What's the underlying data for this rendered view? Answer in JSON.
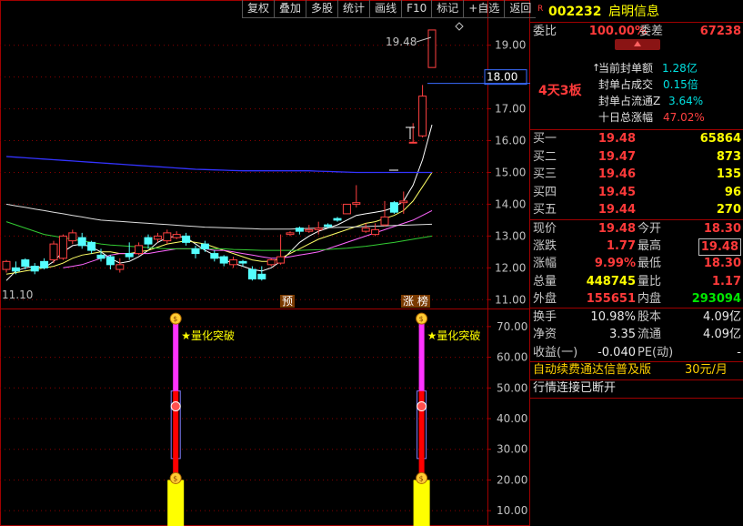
{
  "toolbar": [
    "复权",
    "叠加",
    "多股",
    "统计",
    "画线",
    "F10",
    "标记",
    "+自选",
    "返回"
  ],
  "stock": {
    "marker": "R",
    "code": "002232",
    "name": "启明信息"
  },
  "weibi": {
    "label": "委比",
    "value": "100.00%",
    "diff_label": "委差",
    "diff_value": "67238"
  },
  "limit_info": {
    "boards": "4天3板",
    "items": [
      {
        "label": "当前封单额",
        "value": "1.28亿"
      },
      {
        "label": "封单占成交",
        "value": "0.15倍"
      },
      {
        "label": "封单占流通Z",
        "value": "3.64%"
      },
      {
        "label": "十日总涨幅",
        "value": "47.02%"
      }
    ]
  },
  "bids": [
    {
      "label": "买一",
      "price": "19.48",
      "vol": "65864"
    },
    {
      "label": "买二",
      "price": "19.47",
      "vol": "873"
    },
    {
      "label": "买三",
      "price": "19.46",
      "vol": "135"
    },
    {
      "label": "买四",
      "price": "19.45",
      "vol": "96"
    },
    {
      "label": "买五",
      "price": "19.44",
      "vol": "270"
    }
  ],
  "quote": [
    {
      "l1": "现价",
      "v1": "19.48",
      "l2": "今开",
      "v2": "18.30"
    },
    {
      "l1": "涨跌",
      "v1": "1.77",
      "l2": "最高",
      "v2": "19.48"
    },
    {
      "l1": "涨幅",
      "v1": "9.99%",
      "l2": "最低",
      "v2": "18.30"
    },
    {
      "l1": "总量",
      "v1": "448745",
      "l2": "量比",
      "v2": "1.17"
    },
    {
      "l1": "外盘",
      "v1": "155651",
      "l2": "内盘",
      "v2": "293094"
    }
  ],
  "stats": [
    {
      "l1": "换手",
      "v1": "10.98%",
      "l2": "股本",
      "v2": "4.09亿"
    },
    {
      "l1": "净资",
      "v1": "3.35",
      "l2": "流通",
      "v2": "4.09亿"
    },
    {
      "l1": "收益(一)",
      "v1": "-0.040",
      "l2": "PE(动)",
      "v2": "-"
    }
  ],
  "notice": {
    "text": "自动续费通达信普及版",
    "price": "30元/月"
  },
  "status": "行情连接已断开",
  "chart_data": [
    {
      "type": "candlestick",
      "ylim": [
        10.75,
        19.85
      ],
      "yticks": [
        "19.00",
        "18.00",
        "17.00",
        "16.00",
        "15.00",
        "14.00",
        "13.00",
        "12.00",
        "11.00"
      ],
      "current_price_label": "18.00",
      "high_label": "19.48",
      "low_label": "11.10",
      "badges": [
        "预",
        "涨 榜"
      ],
      "candles": [
        [
          11.95,
          12.2,
          11.85,
          12.25
        ],
        [
          12.0,
          11.9,
          11.8,
          12.2
        ],
        [
          12.25,
          12.05,
          11.95,
          12.3
        ],
        [
          12.05,
          11.9,
          11.8,
          12.15
        ],
        [
          12.2,
          12.0,
          11.95,
          12.3
        ],
        [
          12.25,
          12.75,
          12.15,
          12.85
        ],
        [
          12.3,
          13.0,
          12.25,
          13.05
        ],
        [
          12.85,
          13.1,
          12.75,
          13.2
        ],
        [
          12.95,
          12.7,
          12.6,
          13.1
        ],
        [
          12.8,
          12.55,
          12.45,
          12.85
        ],
        [
          12.4,
          12.3,
          12.2,
          12.6
        ],
        [
          12.35,
          12.1,
          11.95,
          12.4
        ],
        [
          11.95,
          12.1,
          11.85,
          12.3
        ],
        [
          12.45,
          12.35,
          12.25,
          12.8
        ],
        [
          12.45,
          12.7,
          12.4,
          12.8
        ],
        [
          12.95,
          12.75,
          12.6,
          13.05
        ],
        [
          12.9,
          13.0,
          12.8,
          13.1
        ],
        [
          12.85,
          13.1,
          12.75,
          13.2
        ],
        [
          12.95,
          13.05,
          12.9,
          13.15
        ],
        [
          13.0,
          12.8,
          12.7,
          13.1
        ],
        [
          12.6,
          12.45,
          12.3,
          12.7
        ],
        [
          12.75,
          12.6,
          12.5,
          12.85
        ],
        [
          12.45,
          12.3,
          12.2,
          12.55
        ],
        [
          12.35,
          12.15,
          12.05,
          12.4
        ],
        [
          12.1,
          12.25,
          12.0,
          12.35
        ],
        [
          12.2,
          12.15,
          12.05,
          12.25
        ],
        [
          11.95,
          11.65,
          11.6,
          12.05
        ],
        [
          11.8,
          11.65,
          11.6,
          12.05
        ],
        [
          12.1,
          12.25,
          12.05,
          12.3
        ],
        [
          12.15,
          12.35,
          12.1,
          13.05
        ],
        [
          13.05,
          13.1,
          13.0,
          13.15
        ],
        [
          13.25,
          13.15,
          13.05,
          13.3
        ],
        [
          13.15,
          13.2,
          13.1,
          13.35
        ],
        [
          13.2,
          13.25,
          13.05,
          13.45
        ],
        [
          13.35,
          13.3,
          13.25,
          13.4
        ],
        [
          13.55,
          13.5,
          13.45,
          13.6
        ],
        [
          13.7,
          14.0,
          13.9,
          14.0
        ],
        [
          14.0,
          14.05,
          13.9,
          14.6
        ],
        [
          13.15,
          13.25,
          13.1,
          13.4
        ],
        [
          13.05,
          13.2,
          13.0,
          13.4
        ],
        [
          13.35,
          13.6,
          13.3,
          14.1
        ],
        [
          14.05,
          13.75,
          13.7,
          14.1
        ],
        [
          14.05,
          14.1,
          13.7,
          14.4
        ],
        [
          15.95,
          15.95,
          15.95,
          16.55
        ],
        [
          16.15,
          17.4,
          16.1,
          17.75
        ],
        [
          18.3,
          19.48,
          18.3,
          19.48
        ]
      ],
      "ma_lines": [
        {
          "color": "#ffffff",
          "values": [
            11.6,
            11.9,
            12.0,
            12.05,
            12.0,
            12.2,
            12.5,
            12.7,
            12.75,
            12.65,
            12.5,
            12.3,
            12.15,
            12.2,
            12.35,
            12.55,
            12.8,
            12.95,
            13.0,
            12.95,
            12.75,
            12.55,
            12.4,
            12.25,
            12.15,
            12.05,
            11.95,
            11.9,
            12.0,
            12.2,
            12.5,
            12.8,
            13.0,
            13.15,
            13.25,
            13.35,
            13.5,
            13.65,
            13.7,
            13.75,
            13.8,
            13.9,
            14.1,
            14.6,
            15.4,
            16.5
          ]
        },
        {
          "color": "#ffff66",
          "values": [
            11.8,
            11.85,
            11.9,
            11.95,
            12.0,
            12.05,
            12.15,
            12.3,
            12.4,
            12.45,
            12.5,
            12.5,
            12.45,
            12.45,
            12.5,
            12.55,
            12.65,
            12.75,
            12.8,
            12.85,
            12.8,
            12.75,
            12.65,
            12.55,
            12.45,
            12.35,
            12.25,
            12.2,
            12.2,
            12.3,
            12.45,
            12.6,
            12.75,
            12.9,
            13.0,
            13.1,
            13.2,
            13.3,
            13.4,
            13.45,
            13.55,
            13.65,
            13.8,
            14.1,
            14.55,
            15.0
          ]
        },
        {
          "color": "#ff66ff",
          "values": [
            null,
            null,
            null,
            null,
            null,
            null,
            12.0,
            12.05,
            12.1,
            12.2,
            12.3,
            12.4,
            12.45,
            12.45,
            12.45,
            12.45,
            12.5,
            12.55,
            12.6,
            12.6,
            12.6,
            12.6,
            12.55,
            12.55,
            12.5,
            12.45,
            12.4,
            12.35,
            12.3,
            12.3,
            12.35,
            12.4,
            12.45,
            12.5,
            12.6,
            12.7,
            12.8,
            12.9,
            13.0,
            13.1,
            13.2,
            13.3,
            13.4,
            13.5,
            13.65,
            13.8
          ]
        },
        {
          "color": "#33cc33",
          "values": [
            13.45,
            13.35,
            13.25,
            13.15,
            13.05,
            13.0,
            12.95,
            12.9,
            12.85,
            12.8,
            12.75,
            12.72,
            12.7,
            12.68,
            12.66,
            12.64,
            12.62,
            12.6,
            12.6,
            12.6,
            12.6,
            12.6,
            12.6,
            12.6,
            12.58,
            12.57,
            12.56,
            12.55,
            12.55,
            12.55,
            12.55,
            12.55,
            12.56,
            12.57,
            12.58,
            12.6,
            12.62,
            12.65,
            12.68,
            12.72,
            12.76,
            12.8,
            12.85,
            12.9,
            12.95,
            13.0
          ]
        },
        {
          "color": "#dddddd",
          "values": [
            14.0,
            13.95,
            13.9,
            13.85,
            13.8,
            13.75,
            13.7,
            13.65,
            13.6,
            13.55,
            13.5,
            13.48,
            13.46,
            13.44,
            13.42,
            13.4,
            13.38,
            13.36,
            13.34,
            13.32,
            13.3,
            13.28,
            13.27,
            13.26,
            13.25,
            13.24,
            13.23,
            13.22,
            13.22,
            13.22,
            13.22,
            13.23,
            13.24,
            13.25,
            13.26,
            13.27,
            13.28,
            13.29,
            13.3,
            13.31,
            13.32,
            13.33,
            13.34,
            13.35,
            13.36,
            13.37
          ]
        },
        {
          "color": "#3333ff",
          "values": [
            15.5,
            15.48,
            15.46,
            15.44,
            15.42,
            15.4,
            15.38,
            15.36,
            15.34,
            15.32,
            15.3,
            15.28,
            15.26,
            15.24,
            15.22,
            15.2,
            15.18,
            15.16,
            15.14,
            15.12,
            15.1,
            15.09,
            15.08,
            15.07,
            15.06,
            15.05,
            15.05,
            15.05,
            15.05,
            15.05,
            15.05,
            15.05,
            15.05,
            15.04,
            15.03,
            15.02,
            15.01,
            15.0,
            15.0,
            15.0,
            15.0,
            15.0,
            15.0,
            15.0,
            15.0,
            15.0
          ]
        }
      ]
    },
    {
      "type": "indicator",
      "ylim": [
        5,
        75
      ],
      "yticks": [
        "70.00",
        "60.00",
        "50.00",
        "40.00",
        "30.00",
        "20.00",
        "10.00"
      ],
      "signal_label": "★量化突破",
      "signals": [
        {
          "index": 18,
          "top": 72,
          "mid": 44,
          "bottom": 20
        },
        {
          "index": 44,
          "top": 72,
          "mid": 44,
          "bottom": 20
        }
      ]
    }
  ]
}
